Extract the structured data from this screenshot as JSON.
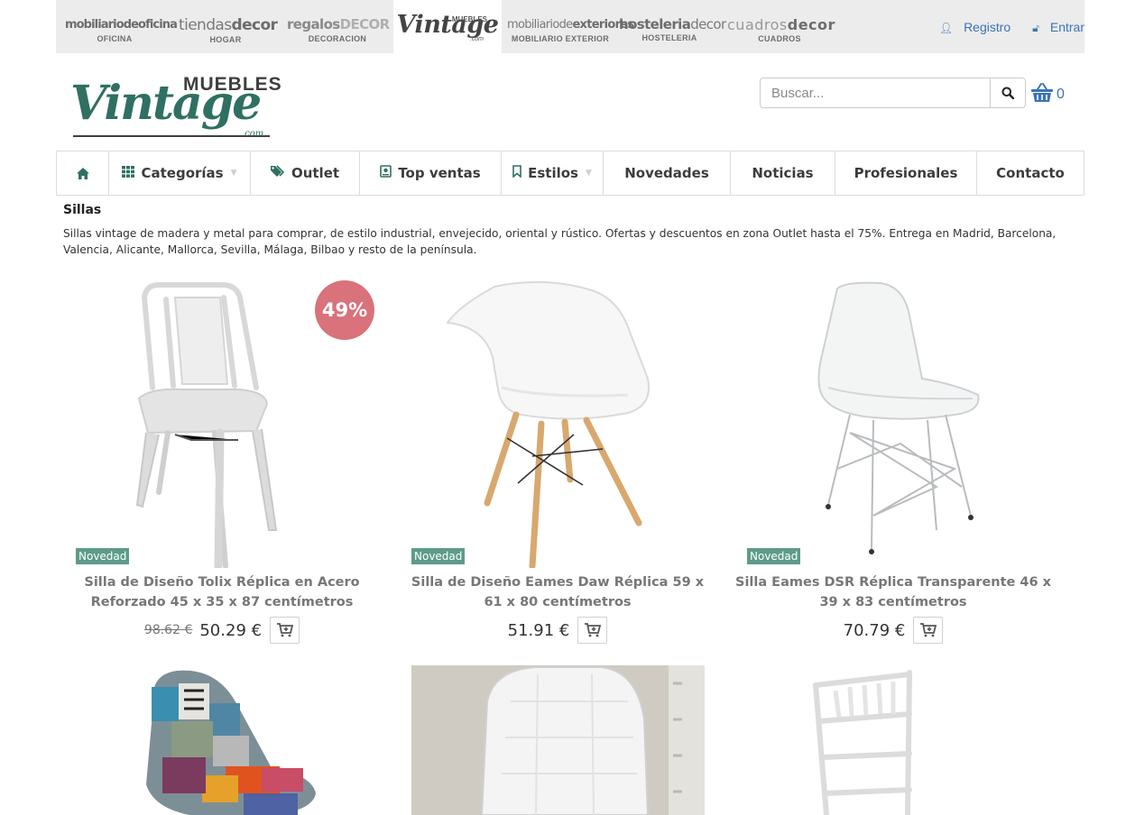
{
  "stores": [
    {
      "name_a": "mobiliario",
      "name_b": "deoficina",
      "sub": "OFICINA"
    },
    {
      "name_a": "tiendas",
      "name_b": "decor",
      "sub": "HOGAR"
    },
    {
      "name_a": "regalos",
      "name_b": "DECOR",
      "sub": "DECORACION"
    },
    {
      "name_a": "Vintage",
      "name_b": "MUEBLES",
      "sub": ".com"
    },
    {
      "name_a": "mobiliariode",
      "name_b": "exteriores",
      "sub": "MOBILIARIO EXTERIOR"
    },
    {
      "name_a": "hosteleria",
      "name_b": "decor",
      "sub": "HOSTELERIA"
    },
    {
      "name_a": "cuadros",
      "name_b": "decor",
      "sub": "CUADROS"
    }
  ],
  "top_links": {
    "register": "Registro",
    "login": "Entrar"
  },
  "brand": {
    "muebles": "MUEBLES",
    "vintage": "Vintage",
    "com": ".com"
  },
  "search": {
    "placeholder": "Buscar..."
  },
  "cart": {
    "count": "0"
  },
  "nav": {
    "categories": "Categorías",
    "outlet": "Outlet",
    "top": "Top ventas",
    "styles": "Estilos",
    "news": "Novedades",
    "blog": "Noticias",
    "pro": "Profesionales",
    "contact": "Contacto"
  },
  "category": {
    "title": "Sillas",
    "description": "Sillas vintage de madera y metal para comprar, de estilo industrial, envejecido, oriental y rústico. Ofertas y descuentos en zona Outlet hasta el 75%. Entrega en Madrid, Barcelona, Valencia, Alicante, Mallorca, Sevilla, Málaga, Bilbao y resto de la península."
  },
  "products": [
    {
      "badge": "49%",
      "tag": "Novedad",
      "name": "Silla de Diseño Tolix Réplica en Acero Reforzado 45 x 35 x 87 centímetros",
      "old_price": "98.62 €",
      "price": "50.29 €"
    },
    {
      "tag": "Novedad",
      "name": "Silla de Diseño Eames Daw Réplica 59 x 61 x 80 centímetros",
      "price": "51.91 €"
    },
    {
      "tag": "Novedad",
      "name": "Silla Eames DSR Réplica Transparente 46 x 39 x 83 centímetros",
      "price": "70.79 €"
    }
  ],
  "colors": {
    "brand": "#2f7062",
    "link": "#3a74b8",
    "discount": "#d9727a",
    "new_tag": "#5d9b8a"
  }
}
